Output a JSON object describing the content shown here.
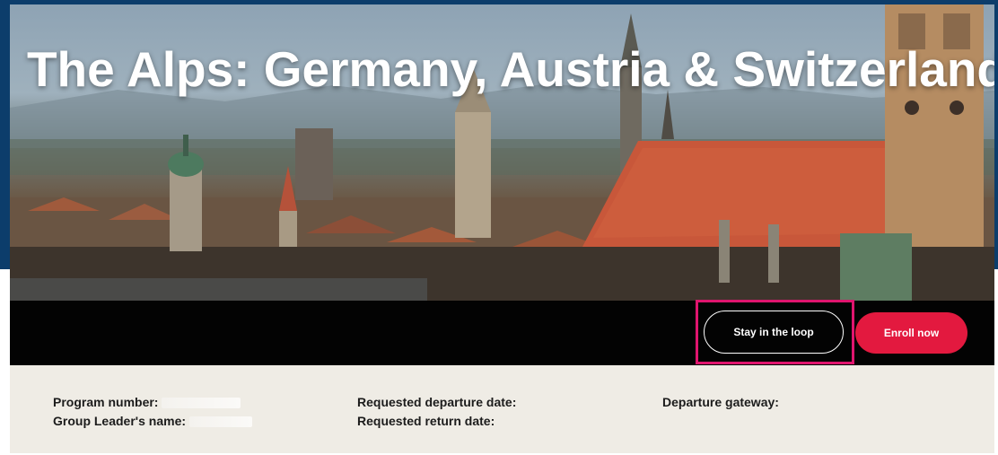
{
  "hero": {
    "title": "The Alps: Germany, Austria & Switzerland"
  },
  "actions": {
    "stay_in_loop_label": "Stay in the loop",
    "enroll_label": "Enroll now"
  },
  "program_info": {
    "program_number_label": "Program number:",
    "group_leader_label": "Group Leader's name:",
    "departure_date_label": "Requested departure date:",
    "return_date_label": "Requested return date:",
    "gateway_label": "Departure gateway:"
  },
  "colors": {
    "frame": "#0c3d6b",
    "enroll_button": "#e3193f",
    "highlight_border": "#e0156e",
    "info_panel": "#efece5"
  }
}
